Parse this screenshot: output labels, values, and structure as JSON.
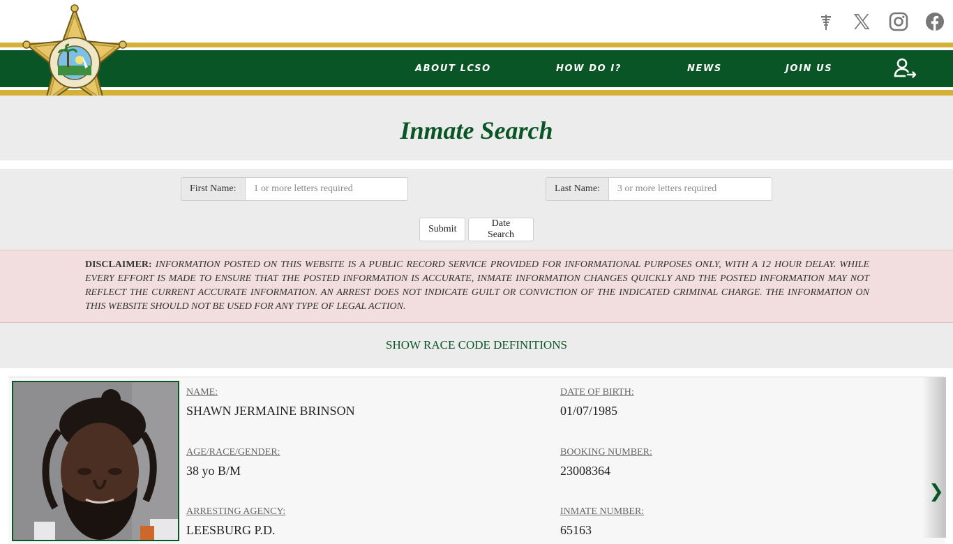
{
  "header": {
    "social": [
      {
        "icon": "nextdoor-icon"
      },
      {
        "icon": "x-twitter-icon"
      },
      {
        "icon": "instagram-icon"
      },
      {
        "icon": "facebook-icon"
      }
    ],
    "nav": [
      {
        "label": "ABOUT LCSO"
      },
      {
        "label": "HOW DO I?"
      },
      {
        "label": "NEWS"
      },
      {
        "label": "JOIN US"
      }
    ],
    "badge": {
      "top_text": "OFFICE OF THE SHERIFF",
      "county": "LAKE COUNTY",
      "state": "FLORIDA"
    },
    "colors": {
      "green": "#0a5526",
      "gold": "#d4b037"
    }
  },
  "page": {
    "title": "Inmate Search"
  },
  "search": {
    "first_name_label": "First Name:",
    "first_name_placeholder": "1 or more letters required",
    "first_name_value": "",
    "last_name_label": "Last Name:",
    "last_name_placeholder": "3 or more letters required",
    "last_name_value": "",
    "submit_label": "Submit",
    "date_search_label": "Date Search"
  },
  "disclaimer": {
    "lead": "DISCLAIMER:",
    "body": "INFORMATION POSTED ON THIS WEBSITE IS A PUBLIC RECORD SERVICE PROVIDED FOR INFORMATIONAL PURPOSES ONLY, WITH A 12 HOUR DELAY. WHILE EVERY EFFORT IS MADE TO ENSURE THAT THE POSTED INFORMATION IS ACCURATE, INMATE INFORMATION CHANGES QUICKLY AND THE POSTED INFORMATION MAY NOT REFLECT THE CURRENT ACCURATE INFORMATION. AN ARREST DOES NOT INDICATE GUILT OR CONVICTION OF THE INDICATED CRIMINAL CHARGE. THE INFORMATION ON THIS WEBSITE SHOULD NOT BE USED FOR ANY TYPE OF LEGAL ACTION."
  },
  "race_codes_link": "SHOW RACE CODE DEFINITIONS",
  "inmate": {
    "name_label": "NAME:",
    "name": "SHAWN JERMAINE BRINSON",
    "dob_label": "DATE OF BIRTH:",
    "dob": "01/07/1985",
    "age_label": "AGE/RACE/GENDER:",
    "age_race_gender": "38 yo B/M",
    "booking_label": "BOOKING NUMBER:",
    "booking_number": "23008364",
    "agency_label": "ARRESTING AGENCY:",
    "agency": "LEESBURG P.D.",
    "inmate_number_label": "INMATE NUMBER:",
    "inmate_number": "65163"
  },
  "carousel": {
    "next_glyph": "❯"
  }
}
